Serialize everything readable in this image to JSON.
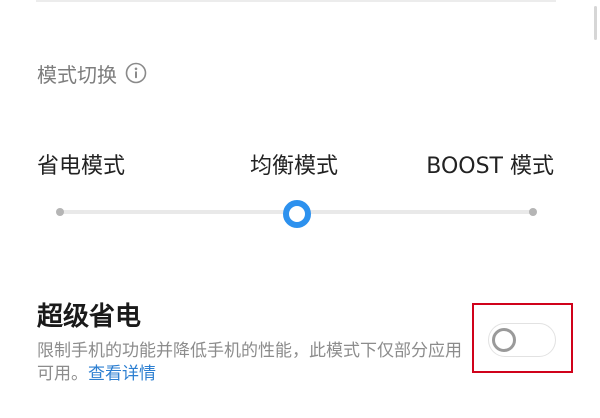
{
  "section": {
    "title": "模式切换",
    "info_icon": "info-circle-icon"
  },
  "modes": {
    "options": [
      "省电模式",
      "均衡模式",
      "BOOST 模式"
    ],
    "selected_index": 1
  },
  "super_power_saving": {
    "title": "超级省电",
    "description": "限制手机的功能并降低手机的性能，此模式下仅部分应用可用。",
    "link_text": "查看详情",
    "enabled": false
  },
  "colors": {
    "accent": "#2d91ee",
    "link": "#2d7fd1",
    "highlight": "#d0021b"
  }
}
